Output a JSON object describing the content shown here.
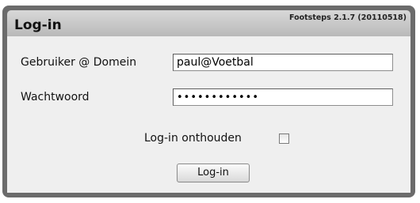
{
  "header": {
    "title": "Log-in",
    "version": "Footsteps 2.1.7 (20110518)"
  },
  "form": {
    "user_label": "Gebruiker @ Domein",
    "user_value": "paul@Voetbal",
    "password_label": "Wachtwoord",
    "password_value": "••••••••••••",
    "remember_label": "Log-in onthouden",
    "remember_checked": false,
    "submit_label": "Log-in"
  }
}
